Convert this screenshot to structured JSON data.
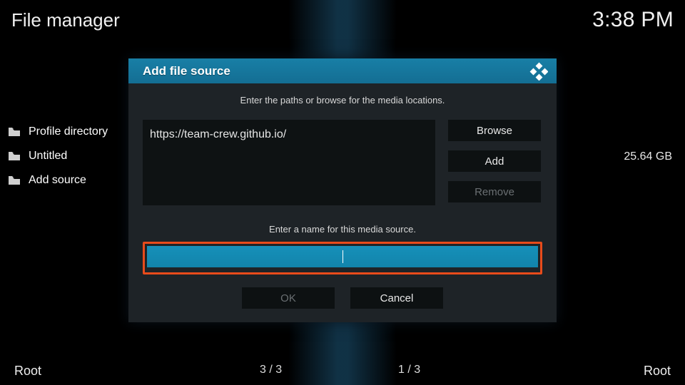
{
  "header": {
    "title": "File manager",
    "clock": "3:38 PM"
  },
  "sidebar": {
    "items": [
      {
        "label": "Profile directory"
      },
      {
        "label": "Untitled"
      },
      {
        "label": "Add source"
      }
    ]
  },
  "right": {
    "size": "25.64 GB"
  },
  "footer": {
    "left": "Root",
    "right": "Root",
    "count_left": "3 / 3",
    "count_right": "1 / 3"
  },
  "dialog": {
    "title": "Add file source",
    "instruction": "Enter the paths or browse for the media locations.",
    "path_value": "https://team-crew.github.io/",
    "browse": "Browse",
    "add": "Add",
    "remove": "Remove",
    "name_instruction": "Enter a name for this media source.",
    "name_value": "",
    "ok": "OK",
    "cancel": "Cancel"
  }
}
